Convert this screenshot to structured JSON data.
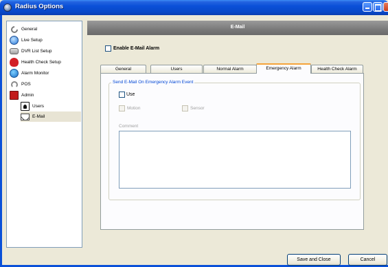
{
  "window": {
    "title": "Radius Options"
  },
  "tree": {
    "items": [
      {
        "label": "General",
        "icon": "wrench-icon"
      },
      {
        "label": "Live Setup",
        "icon": "live-icon"
      },
      {
        "label": "DVR List Setup",
        "icon": "dvr-icon"
      },
      {
        "label": "Health Check Setup",
        "icon": "heart-icon"
      },
      {
        "label": "Alarm Monitor",
        "icon": "alarm-icon"
      },
      {
        "label": "POS",
        "icon": "pos-icon"
      },
      {
        "label": "Admin",
        "icon": "admin-icon"
      },
      {
        "label": "Users",
        "icon": "users-icon"
      },
      {
        "label": "E-Mail",
        "icon": "email-icon",
        "selected": true
      }
    ]
  },
  "header": {
    "title": "E-Mail"
  },
  "enable_email_alarm": {
    "label": "Enable E-Mail Alarm",
    "checked": false
  },
  "tabs": [
    {
      "label": "General"
    },
    {
      "label": "Users"
    },
    {
      "label": "Normal Alarm"
    },
    {
      "label": "Emergency Alarm",
      "active": true
    },
    {
      "label": "Health Check Alarm"
    }
  ],
  "group": {
    "title": "Send E-Mail On Emergency Alarm Event",
    "use_label": "Use",
    "use_checked": false,
    "motion_label": "Motion",
    "sensor_label": "Sensor",
    "comment_label": "Comment",
    "comment_value": ""
  },
  "buttons": {
    "save": "Save and Close",
    "cancel": "Cancel"
  },
  "colors": {
    "titlebar": "#0a50d8",
    "tab_active_accent": "#f5a33a",
    "group_title": "#0046d5"
  }
}
